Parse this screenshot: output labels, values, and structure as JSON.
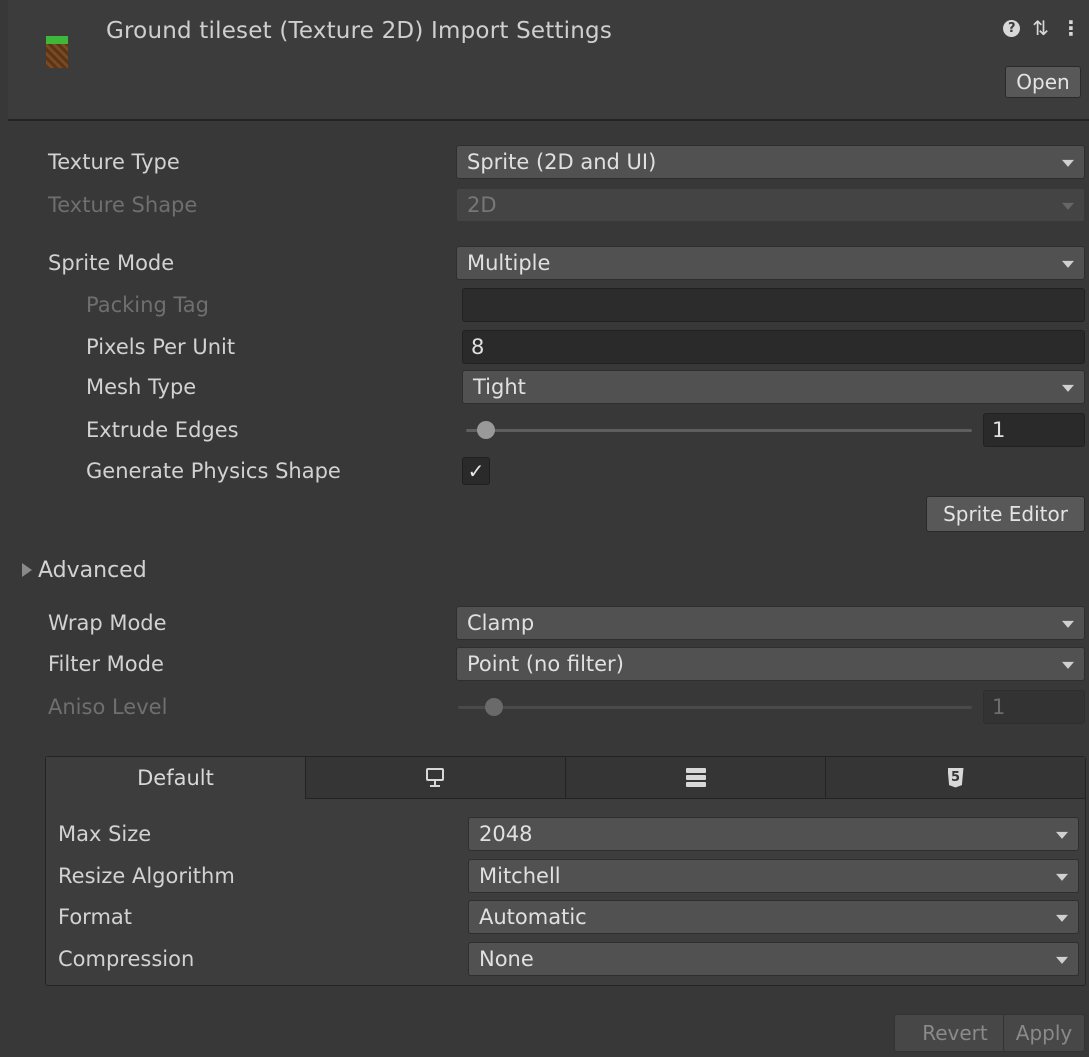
{
  "header": {
    "title": "Ground tileset (Texture 2D) Import Settings",
    "open_label": "Open",
    "icons": [
      "help-icon",
      "presets-icon",
      "kebab-menu-icon"
    ]
  },
  "fields": {
    "texture_type": {
      "label": "Texture Type",
      "value": "Sprite (2D and UI)"
    },
    "texture_shape": {
      "label": "Texture Shape",
      "value": "2D"
    },
    "sprite_mode": {
      "label": "Sprite Mode",
      "value": "Multiple"
    },
    "packing_tag": {
      "label": "Packing Tag",
      "value": ""
    },
    "pixels_per_unit": {
      "label": "Pixels Per Unit",
      "value": "8"
    },
    "mesh_type": {
      "label": "Mesh Type",
      "value": "Tight"
    },
    "extrude_edges": {
      "label": "Extrude Edges",
      "value": "1",
      "slider_fraction": 0.04
    },
    "generate_physics_shape": {
      "label": "Generate Physics Shape",
      "checked": true,
      "check_glyph": "✓"
    },
    "sprite_editor_label": "Sprite Editor",
    "advanced_label": "Advanced",
    "wrap_mode": {
      "label": "Wrap Mode",
      "value": "Clamp"
    },
    "filter_mode": {
      "label": "Filter Mode",
      "value": "Point (no filter)"
    },
    "aniso_level": {
      "label": "Aniso Level",
      "value": "1",
      "slider_fraction": 0.07
    }
  },
  "platform": {
    "tabs": [
      {
        "label": "Default",
        "active": true
      },
      {
        "icon": "monitor-icon"
      },
      {
        "icon": "server-icon"
      },
      {
        "icon": "html5-icon"
      }
    ],
    "max_size": {
      "label": "Max Size",
      "value": "2048"
    },
    "resize_algorithm": {
      "label": "Resize Algorithm",
      "value": "Mitchell"
    },
    "format": {
      "label": "Format",
      "value": "Automatic"
    },
    "compression": {
      "label": "Compression",
      "value": "None"
    }
  },
  "footer": {
    "revert_label": "Revert",
    "apply_label": "Apply"
  },
  "colors": {
    "background": "#383838",
    "dropdown": "#515151",
    "field": "#2a2a2a",
    "text": "#d2d2d2",
    "disabled_text": "#6f6f6f"
  }
}
